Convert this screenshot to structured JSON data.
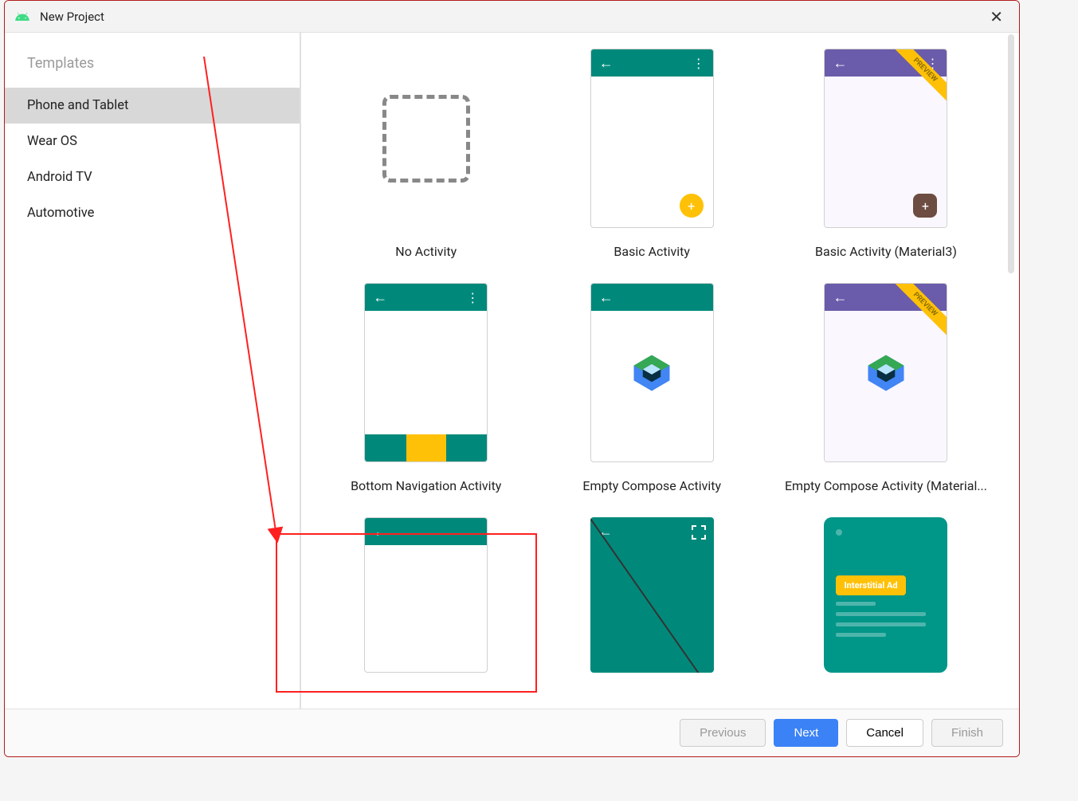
{
  "window": {
    "title": "New Project"
  },
  "sidebar": {
    "header": "Templates",
    "items": [
      {
        "label": "Phone and Tablet",
        "selected": true
      },
      {
        "label": "Wear OS",
        "selected": false
      },
      {
        "label": "Android TV",
        "selected": false
      },
      {
        "label": "Automotive",
        "selected": false
      }
    ]
  },
  "templates": [
    {
      "label": "No Activity",
      "kind": "empty"
    },
    {
      "label": "Basic Activity",
      "kind": "basic-teal"
    },
    {
      "label": "Basic Activity (Material3)",
      "kind": "basic-purple-preview"
    },
    {
      "label": "Bottom Navigation Activity",
      "kind": "bottom-nav"
    },
    {
      "label": "Empty Compose Activity",
      "kind": "compose-teal"
    },
    {
      "label": "Empty Compose Activity (Material...",
      "kind": "compose-purple-preview"
    },
    {
      "label": "",
      "kind": "plain-teal"
    },
    {
      "label": "",
      "kind": "fullscreen"
    },
    {
      "label": "",
      "kind": "ad"
    }
  ],
  "preview_ribbon": "PREVIEW",
  "ad_button": "Interstitial Ad",
  "footer": {
    "previous": "Previous",
    "next": "Next",
    "cancel": "Cancel",
    "finish": "Finish"
  }
}
